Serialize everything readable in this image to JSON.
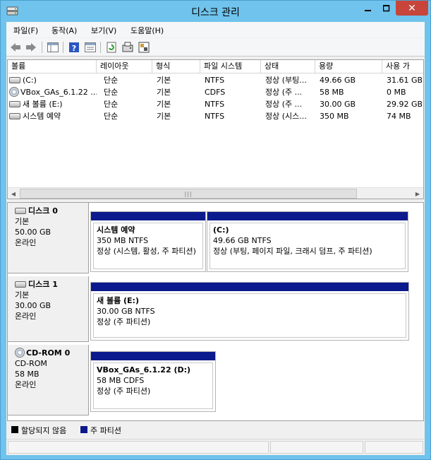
{
  "window": {
    "title": "디스크 관리",
    "close_glyph": "✕"
  },
  "menu": [
    "파일(F)",
    "동작(A)",
    "보기(V)",
    "도움말(H)"
  ],
  "toolbar": [
    "back-icon",
    "forward-icon",
    "console-tree-icon",
    "help-icon",
    "properties-icon",
    "refresh-icon",
    "rescan-icon",
    "settings-icon"
  ],
  "volume_table": {
    "headers": [
      "볼륨",
      "레이아웃",
      "형식",
      "파일 시스템",
      "상태",
      "용량",
      "사용 가"
    ],
    "rows": [
      {
        "icon": "drive-icon",
        "name": "(C:)",
        "layout": "단순",
        "type": "기본",
        "fs": "NTFS",
        "status": "정상 (부팅...",
        "capacity": "49.66 GB",
        "free": "31.61 GB"
      },
      {
        "icon": "cd-icon",
        "name": "VBox_GAs_6.1.22 ...",
        "layout": "단순",
        "type": "기본",
        "fs": "CDFS",
        "status": "정상 (주 ...",
        "capacity": "58 MB",
        "free": "0 MB"
      },
      {
        "icon": "drive-icon",
        "name": "새 볼륨 (E:)",
        "layout": "단순",
        "type": "기본",
        "fs": "NTFS",
        "status": "정상 (주 ...",
        "capacity": "30.00 GB",
        "free": "29.92 GB"
      },
      {
        "icon": "drive-icon",
        "name": "시스템 예약",
        "layout": "단순",
        "type": "기본",
        "fs": "NTFS",
        "status": "정상 (시스...",
        "capacity": "350 MB",
        "free": "74 MB"
      }
    ]
  },
  "disks": [
    {
      "name": "디스크 0",
      "kind": "기본",
      "size": "50.00 GB",
      "state": "온라인",
      "partitions": [
        {
          "name": "시스템 예약",
          "detail": "350 MB NTFS",
          "status": "정상 (시스템, 활성, 주 파티션)"
        },
        {
          "name": "(C:)",
          "detail": "49.66 GB NTFS",
          "status": "정상 (부팅, 페이지 파일, 크래시 덤프, 주 파티션)"
        }
      ]
    },
    {
      "name": "디스크 1",
      "kind": "기본",
      "size": "30.00 GB",
      "state": "온라인",
      "partitions": [
        {
          "name": "새 볼륨  (E:)",
          "detail": "30.00 GB NTFS",
          "status": "정상 (주 파티션)"
        }
      ]
    },
    {
      "name": "CD-ROM 0",
      "kind": "CD-ROM",
      "size": "58 MB",
      "state": "온라인",
      "partitions": [
        {
          "name": "VBox_GAs_6.1.22  (D:)",
          "detail": "58 MB CDFS",
          "status": "정상 (주 파티션)"
        }
      ]
    }
  ],
  "legend": [
    {
      "label": "할당되지 않음",
      "color": "#000000"
    },
    {
      "label": "주 파티션",
      "color": "#0b1a8c"
    }
  ]
}
